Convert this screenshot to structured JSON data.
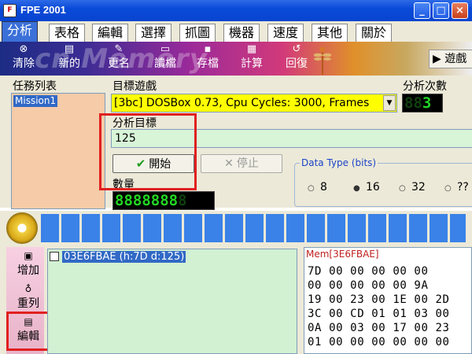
{
  "window": {
    "title": "FPE 2001"
  },
  "tabs": [
    "分析",
    "表格",
    "編輯",
    "選擇",
    "抓圖",
    "機器",
    "速度",
    "其他",
    "關於"
  ],
  "toolbar": {
    "watermark": "cn Memory",
    "items": [
      "清除",
      "新的",
      "更名",
      "讀檔",
      "存檔",
      "計算",
      "回復"
    ],
    "right_label": "遊戲"
  },
  "task_list": {
    "label": "任務列表",
    "items": [
      "Mission1"
    ]
  },
  "target_game": {
    "label": "目標遊戲",
    "value": "[3bc] DOSBox 0.73, Cpu Cycles:     3000, Frames"
  },
  "analysis_count": {
    "label": "分析次數",
    "digits": "3"
  },
  "analysis_target": {
    "label": "分析目標",
    "value": "125"
  },
  "buttons": {
    "start": "開始",
    "stop": "停止"
  },
  "quantity": {
    "label": "數量",
    "digits": "8888888"
  },
  "data_type": {
    "legend": "Data Type (bits)",
    "options": [
      "8",
      "16",
      "32",
      "??"
    ],
    "selected": "16"
  },
  "side_buttons": [
    "增加",
    "重列",
    "編輯"
  ],
  "address_list": {
    "items": [
      {
        "text": "03E6FBAE (h:7D d:125)",
        "checked": false
      }
    ]
  },
  "memory": {
    "header": "Mem[3E6FBAE]",
    "rows": [
      "7D 00 00 00 00 00",
      "00 00 00 00 00 9A",
      "19 00 23 00 1E 00 2D",
      "3C 00 CD 01 01 03 00",
      "0A 00 03 00 17 00 23",
      "01 00 00 00 00 00 00"
    ]
  }
}
